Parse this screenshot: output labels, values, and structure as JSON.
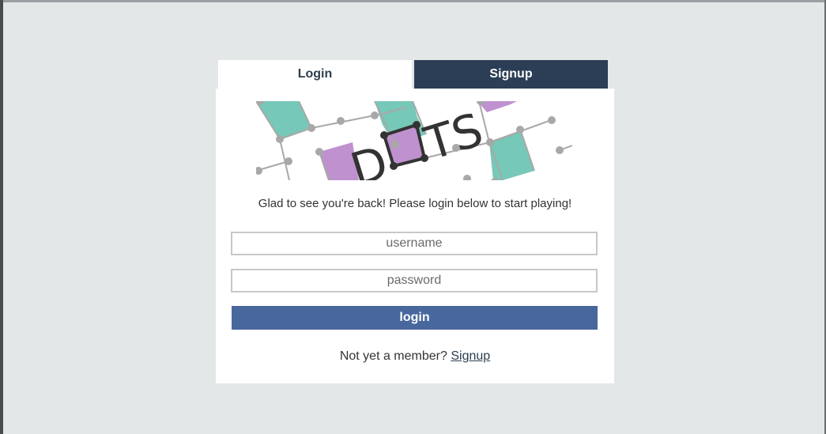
{
  "tabs": {
    "login": "Login",
    "signup": "Signup"
  },
  "logo": {
    "text_d": "D",
    "text_ts": "TS",
    "colors": {
      "teal": "#76c8b8",
      "purple": "#bf92cf",
      "grid": "#a8a8a8",
      "dark": "#333333"
    }
  },
  "welcome_text": "Glad to see you're back! Please login below to start playing!",
  "form": {
    "username_placeholder": "username",
    "password_placeholder": "password",
    "login_label": "login"
  },
  "footer": {
    "prompt": "Not yet a member?",
    "link": "Signup"
  },
  "colors": {
    "background": "#e4e7e8",
    "tab_active": "#ffffff",
    "tab_inactive": "#2c3e55",
    "button": "#48679d"
  }
}
